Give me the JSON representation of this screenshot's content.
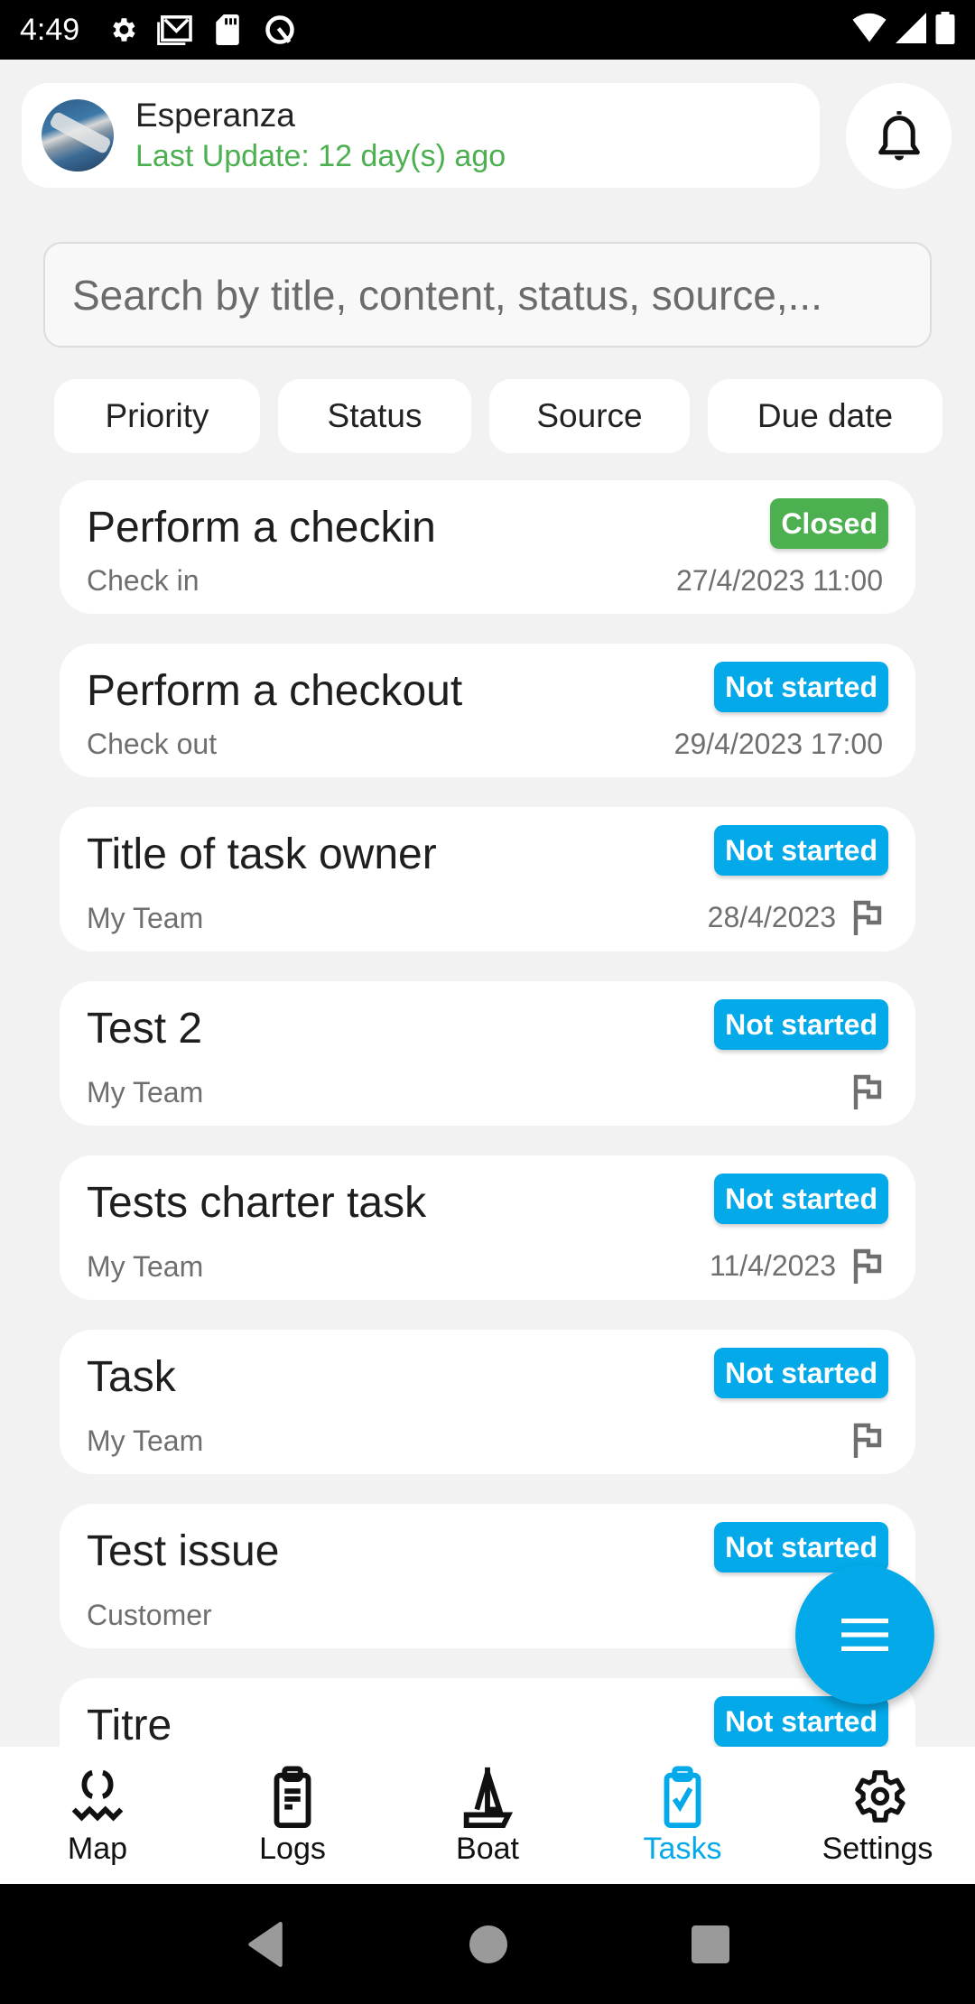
{
  "status_bar": {
    "time": "4:49",
    "left_icons": [
      "settings-icon",
      "gmail-icon",
      "sd-card-icon",
      "vpn-icon"
    ],
    "right_icons": [
      "wifi-icon",
      "signal-icon",
      "battery-icon"
    ]
  },
  "header": {
    "boat_name": "Esperanza",
    "last_update": "Last Update: 12 day(s) ago",
    "notification_icon": "bell-icon"
  },
  "search": {
    "placeholder": "Search by title, content, status, source,...",
    "value": ""
  },
  "filters": [
    "Priority",
    "Status",
    "Source",
    "Due date"
  ],
  "colors": {
    "accent": "#03a9e8",
    "closed": "#4caf50",
    "not_started": "#03a9e8",
    "last_update": "#4caf50"
  },
  "tasks": [
    {
      "title": "Perform a checkin",
      "source": "Check in",
      "status": "Closed",
      "status_color": "#4caf50",
      "due": "27/4/2023 11:00",
      "flag": false
    },
    {
      "title": "Perform a checkout",
      "source": "Check out",
      "status": "Not started",
      "status_color": "#03a9e8",
      "due": "29/4/2023 17:00",
      "flag": false
    },
    {
      "title": "Title of task owner",
      "source": "My Team",
      "status": "Not started",
      "status_color": "#03a9e8",
      "due": "28/4/2023",
      "flag": true
    },
    {
      "title": "Test 2",
      "source": "My Team",
      "status": "Not started",
      "status_color": "#03a9e8",
      "due": "",
      "flag": true
    },
    {
      "title": "Tests charter task",
      "source": "My Team",
      "status": "Not started",
      "status_color": "#03a9e8",
      "due": "11/4/2023",
      "flag": true
    },
    {
      "title": "Task",
      "source": "My Team",
      "status": "Not started",
      "status_color": "#03a9e8",
      "due": "",
      "flag": true
    },
    {
      "title": "Test issue",
      "source": "Customer",
      "status": "Not started",
      "status_color": "#03a9e8",
      "due": "",
      "flag": false
    },
    {
      "title": "Titre",
      "source": "",
      "status": "Not started",
      "status_color": "#03a9e8",
      "due": "",
      "flag": false
    }
  ],
  "fab": {
    "icon": "menu-icon"
  },
  "bottom_nav": [
    {
      "label": "Map",
      "icon": "map-wave-icon",
      "active": false
    },
    {
      "label": "Logs",
      "icon": "clipboard-list-icon",
      "active": false
    },
    {
      "label": "Boat",
      "icon": "sailboat-icon",
      "active": false
    },
    {
      "label": "Tasks",
      "icon": "clipboard-check-icon",
      "active": true
    },
    {
      "label": "Settings",
      "icon": "gear-icon",
      "active": false
    }
  ],
  "system_nav": [
    "back",
    "home",
    "recents"
  ]
}
